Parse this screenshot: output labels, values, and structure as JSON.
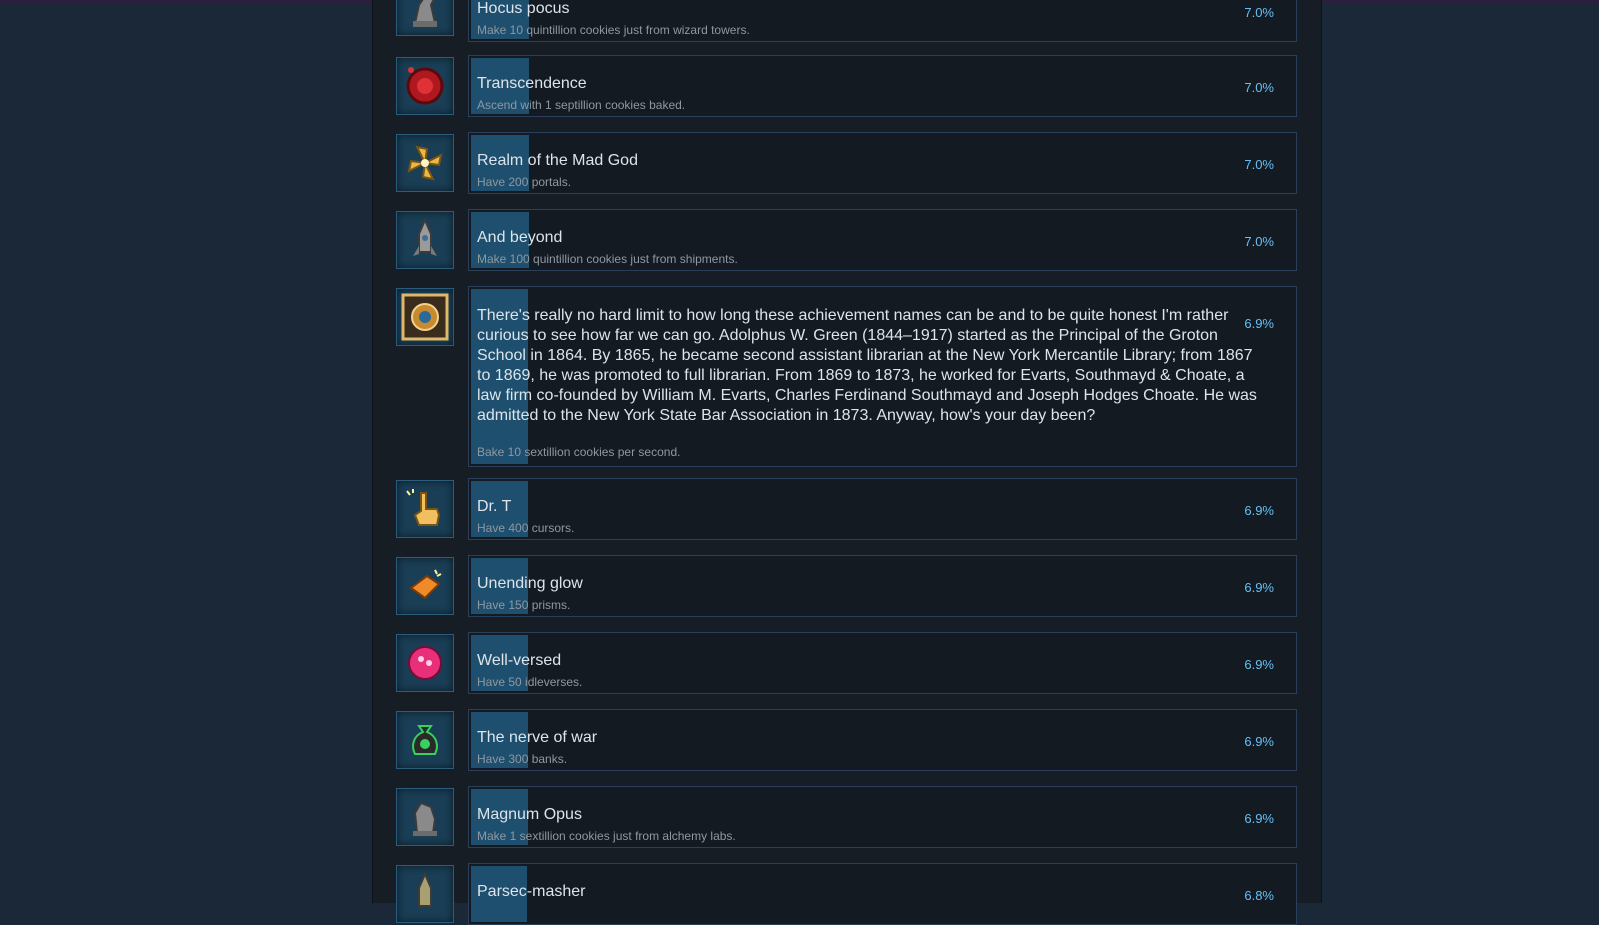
{
  "achievements": [
    {
      "name": "Hocus pocus",
      "desc": "Make 10 quintillion cookies just from wizard towers.",
      "pct": "7.0%",
      "unlock": 0.07,
      "icon": "wizard-tower-icon"
    },
    {
      "name": "Transcendence",
      "desc": "Ascend with 1 septillion cookies baked.",
      "pct": "7.0%",
      "unlock": 0.07,
      "icon": "red-sigil-icon"
    },
    {
      "name": "Realm of the Mad God",
      "desc": "Have 200 portals.",
      "pct": "7.0%",
      "unlock": 0.07,
      "icon": "portal-swirl-icon"
    },
    {
      "name": "And beyond",
      "desc": "Make 100 quintillion cookies just from shipments.",
      "pct": "7.0%",
      "unlock": 0.07,
      "icon": "rocket-icon"
    },
    {
      "name": "There's really no hard limit to how long these achievement names can be and to be quite honest I'm rather curious to see how far we can go. Adolphus W. Green (1844–1917) started as the Principal of the Groton School in 1864. By 1865, he became second assistant librarian at the New York Mercantile Library; from 1867 to 1869, he was promoted to full librarian. From 1869 to 1873, he worked for Evarts, Southmayd & Choate, a law firm co-founded by William M. Evarts, Charles Ferdinand Southmayd and Joseph Hodges Choate. He was admitted to the New York State Bar Association in 1873. Anyway, how's your day been?",
      "desc": "Bake 10 sextillion cookies per second.",
      "pct": "6.9%",
      "unlock": 0.069,
      "icon": "golden-eye-frame-icon"
    },
    {
      "name": "Dr. T",
      "desc": "Have 400 cursors.",
      "pct": "6.9%",
      "unlock": 0.069,
      "icon": "pointing-hand-icon"
    },
    {
      "name": "Unending glow",
      "desc": "Have 150 prisms.",
      "pct": "6.9%",
      "unlock": 0.069,
      "icon": "prism-icon"
    },
    {
      "name": "Well-versed",
      "desc": "Have 50 idleverses.",
      "pct": "6.9%",
      "unlock": 0.069,
      "icon": "pink-orb-icon"
    },
    {
      "name": "The nerve of war",
      "desc": "Have 300 banks.",
      "pct": "6.9%",
      "unlock": 0.069,
      "icon": "money-bag-icon"
    },
    {
      "name": "Magnum Opus",
      "desc": "Make 1 sextillion cookies just from alchemy labs.",
      "pct": "6.9%",
      "unlock": 0.069,
      "icon": "alchemy-flask-icon"
    },
    {
      "name": "Parsec-masher",
      "desc": "",
      "pct": "6.8%",
      "unlock": 0.068,
      "icon": "rocket-icon"
    }
  ],
  "colors": {
    "fill": "#1e4f6e",
    "percent": "#66c0f4",
    "card_border": "#2a3f5a",
    "page_bg": "#1b2838"
  }
}
